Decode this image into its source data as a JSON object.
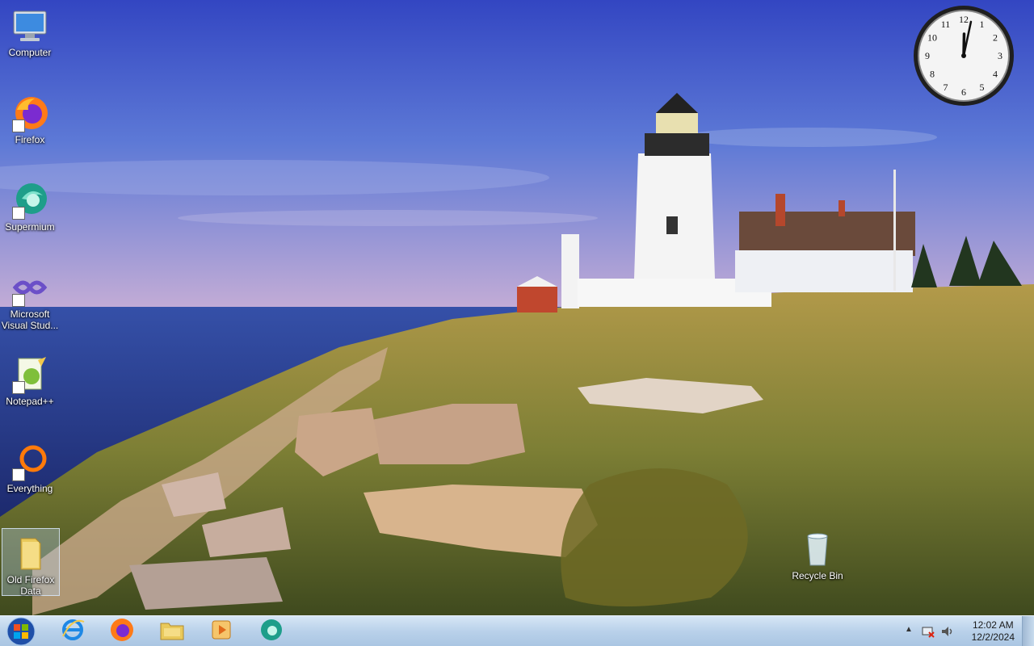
{
  "desktop_icons": [
    {
      "label": "Computer",
      "icon": "computer-icon",
      "shortcut": false
    },
    {
      "label": "Firefox",
      "icon": "firefox-icon",
      "shortcut": true
    },
    {
      "label": "Supermium",
      "icon": "supermium-icon",
      "shortcut": true
    },
    {
      "label": "Microsoft Visual Stud...",
      "icon": "visual-studio-icon",
      "shortcut": true
    },
    {
      "label": "Notepad++",
      "icon": "notepadpp-icon",
      "shortcut": true
    },
    {
      "label": "Everything",
      "icon": "everything-icon",
      "shortcut": true
    },
    {
      "label": "Old Firefox Data",
      "icon": "folder-icon",
      "shortcut": false,
      "selected": true
    }
  ],
  "recycle_bin": {
    "label": "Recycle Bin",
    "icon": "recycle-bin-icon"
  },
  "clock_gadget": {
    "hour": 12,
    "minute": 2,
    "numbers": [
      "12",
      "1",
      "2",
      "3",
      "4",
      "5",
      "6",
      "7",
      "8",
      "9",
      "10",
      "11"
    ]
  },
  "taskbar": {
    "pinned": [
      {
        "name": "internet-explorer",
        "icon": "internet-explorer-icon"
      },
      {
        "name": "firefox",
        "icon": "firefox-icon"
      },
      {
        "name": "file-explorer",
        "icon": "folder-icon"
      },
      {
        "name": "media-player",
        "icon": "media-player-icon"
      },
      {
        "name": "supermium",
        "icon": "supermium-icon"
      }
    ],
    "tray": {
      "time": "12:02 AM",
      "date": "12/2/2024",
      "icons": [
        "show-hidden-icons-icon",
        "network-icon",
        "volume-icon"
      ]
    }
  },
  "colors": {
    "sky_top": "#3a55c4",
    "sky_bottom": "#c9b0d8",
    "sea": "#2a3f8e",
    "grass": "#8a8a3a",
    "taskbar": "#b9d1ea"
  }
}
